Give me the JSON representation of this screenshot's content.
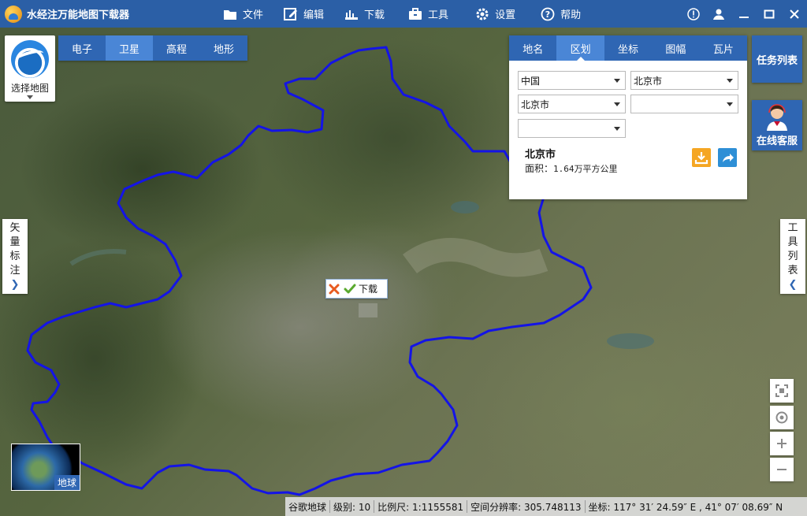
{
  "app": {
    "title": "水经注万能地图下载器"
  },
  "menu": [
    {
      "label": "文件",
      "icon": "folder-icon"
    },
    {
      "label": "编辑",
      "icon": "edit-icon"
    },
    {
      "label": "下载",
      "icon": "download-bars-icon"
    },
    {
      "label": "工具",
      "icon": "toolbox-icon"
    },
    {
      "label": "设置",
      "icon": "gear-icon"
    },
    {
      "label": "帮助",
      "icon": "help-icon"
    }
  ],
  "map_selector": {
    "label": "选择地图"
  },
  "map_tabs": [
    "电子",
    "卫星",
    "高程",
    "地形"
  ],
  "map_tabs_active": "卫星",
  "region_panel": {
    "tabs": [
      "地名",
      "区划",
      "坐标",
      "图幅",
      "瓦片"
    ],
    "active_tab": "区划",
    "dropdowns": [
      "中国",
      "北京市",
      "北京市",
      "",
      ""
    ],
    "name": "北京市",
    "area_label": "面积：",
    "area_value": "1.64万平方公里"
  },
  "right_buttons": {
    "task_list": "任务列表",
    "customer_service": "在线客服"
  },
  "left_tab": {
    "label_chars": [
      "矢",
      "量",
      "标",
      "注"
    ]
  },
  "right_tab": {
    "label_chars": [
      "工",
      "具",
      "列",
      "表"
    ]
  },
  "download_popup": {
    "ok_label": "下载"
  },
  "globe_mini": {
    "label": "地球"
  },
  "statusbar": {
    "source": "谷歌地球",
    "level": "级别: 10",
    "scale": "比例尺: 1:1155581",
    "resolution": "空间分辨率: 305.748113",
    "coords": "坐标: 117° 31′ 24.59″ E , 41° 07′ 08.69″ N"
  },
  "colors": {
    "title_bar": "#2b5fa6",
    "tab_bar": "#2f66b3",
    "tab_active": "#4a86d6",
    "boundary": "#1414e6",
    "download_icon": "#f5a623",
    "share_icon": "#2e8fd6"
  }
}
